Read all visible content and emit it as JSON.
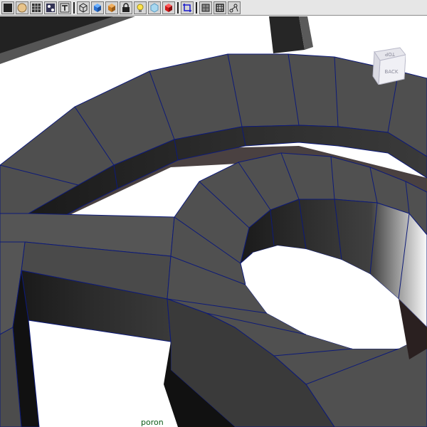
{
  "toolbar": {
    "icons": [
      "select-tool-icon",
      "sphere-icon",
      "grid-icon",
      "snap-icon",
      "text-icon",
      "wireframe-cube-icon",
      "shaded-cube-icon",
      "texture-cube-icon",
      "lock-icon",
      "light-bulb-icon",
      "ice-cube-icon",
      "red-cube-icon",
      "crop-frame-icon",
      "camera-cube-icon",
      "frame-icon",
      "joint-icon"
    ]
  },
  "viewcube": {
    "top_label": "TOP",
    "back_label": "BACK"
  },
  "status": {
    "text": "poron"
  },
  "colors": {
    "mesh": "#4f4f4f",
    "edge": "#0d1a78",
    "shadow": "#1a1a1a",
    "toolbar": "#e6e6e6"
  }
}
